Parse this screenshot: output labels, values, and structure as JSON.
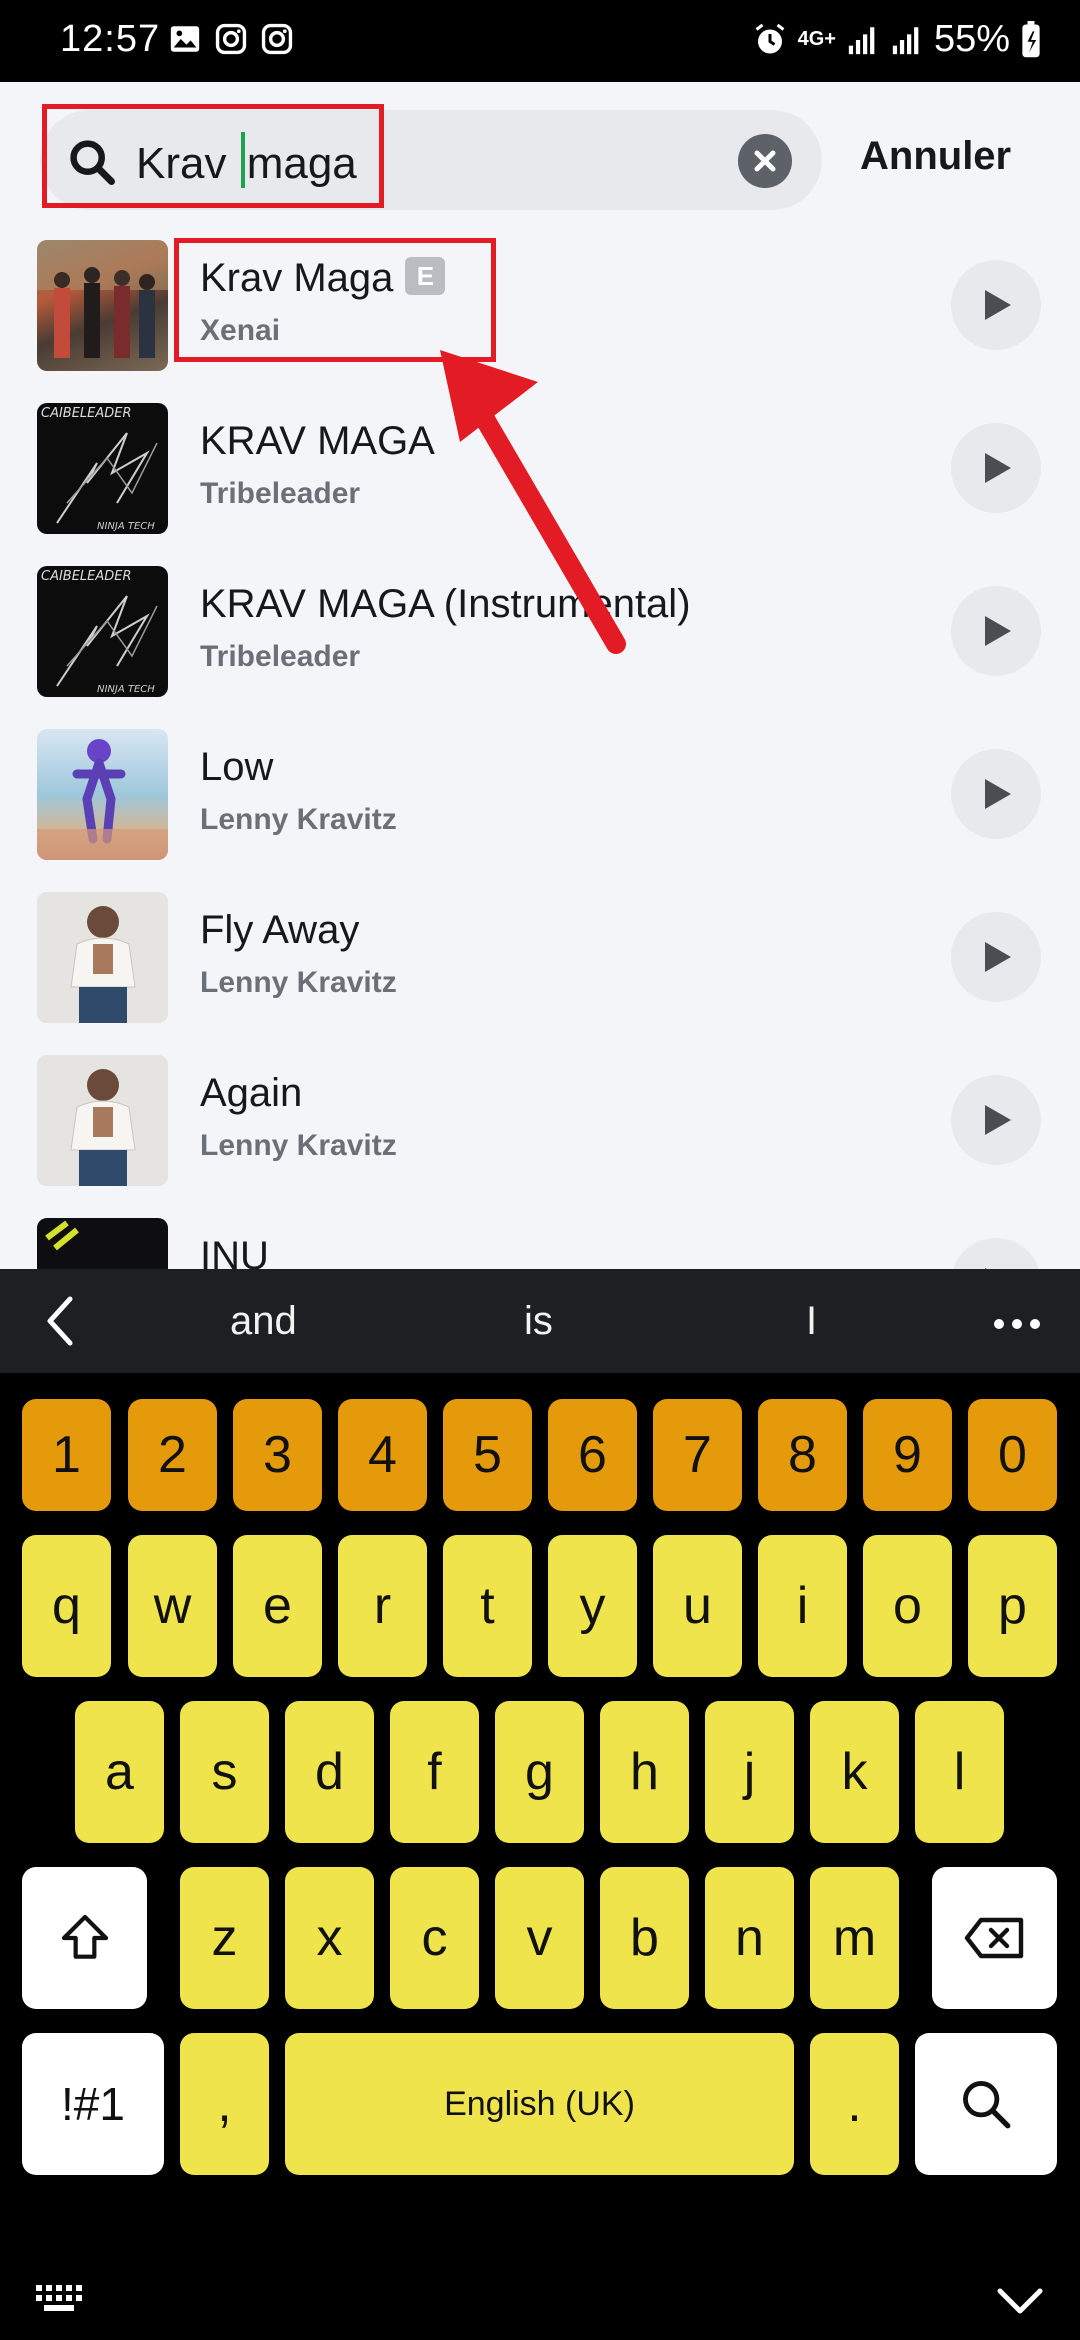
{
  "status_bar": {
    "time": "12:57",
    "network": "4G+",
    "battery": "55%"
  },
  "search": {
    "query_before_caret": "Krav ",
    "query_after_caret": "maga",
    "cancel_label": "Annuler"
  },
  "results": [
    {
      "title": "Krav Maga",
      "artist": "Xenai",
      "explicit": "E"
    },
    {
      "title": "KRAV MAGA",
      "artist": "Tribeleader"
    },
    {
      "title": "KRAV MAGA (Instrumental)",
      "artist": "Tribeleader"
    },
    {
      "title": "Low",
      "artist": "Lenny Kravitz"
    },
    {
      "title": "Fly Away",
      "artist": "Lenny Kravitz"
    },
    {
      "title": "Again",
      "artist": "Lenny Kravitz"
    },
    {
      "title": "INU",
      "artist": ""
    }
  ],
  "keyboard": {
    "suggestions": [
      "and",
      "is",
      "I"
    ],
    "numbers": [
      "1",
      "2",
      "3",
      "4",
      "5",
      "6",
      "7",
      "8",
      "9",
      "0"
    ],
    "row1": [
      "q",
      "w",
      "e",
      "r",
      "t",
      "y",
      "u",
      "i",
      "o",
      "p"
    ],
    "row2": [
      "a",
      "s",
      "d",
      "f",
      "g",
      "h",
      "j",
      "k",
      "l"
    ],
    "row3": [
      "z",
      "x",
      "c",
      "v",
      "b",
      "n",
      "m"
    ],
    "symbols_label": "!#1",
    "comma": ",",
    "space_label": "English (UK)",
    "period": "."
  },
  "colors": {
    "annotation_red": "#e21b24",
    "number_keys": "#e59a0c",
    "letter_keys": "#efe44b"
  }
}
